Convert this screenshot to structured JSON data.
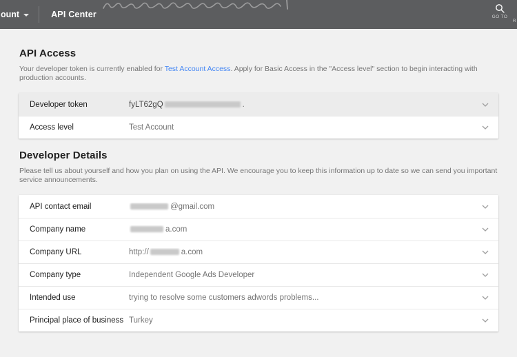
{
  "header": {
    "account_label": "ount",
    "title": "API Center",
    "goto_label": "GO TO",
    "partial_nav_label": "R"
  },
  "colors": {
    "header_bg": "#5c5d5f",
    "page_bg": "#f1f1f1",
    "link_blue": "#4285f4",
    "label_text": "#212121",
    "value_text": "#757575",
    "highlight_row_bg": "#ececec"
  },
  "sections": [
    {
      "title": "API Access",
      "description_before": "Your developer token is currently enabled for ",
      "description_link": "Test Account Access",
      "description_after": ". Apply for Basic Access in the \"Access level\" section to begin interacting with production accounts.",
      "rows": [
        {
          "label": "Developer token",
          "value_prefix": "fyLT62gQ",
          "prefix_dark": true,
          "redacted_width": 110,
          "value_suffix": ".",
          "highlight": true
        },
        {
          "label": "Access level",
          "value": "Test Account"
        }
      ]
    },
    {
      "title": "Developer Details",
      "description": "Please tell us about yourself and how you plan on using the API. We encourage you to keep this information up to date so we can send you important service announcements.",
      "rows": [
        {
          "label": "API contact email",
          "redacted_width": 55,
          "value_suffix": "@gmail.com"
        },
        {
          "label": "Company name",
          "redacted_width": 48,
          "value_suffix": "a.com"
        },
        {
          "label": "Company URL",
          "value_prefix": "http://",
          "redacted_width": 42,
          "value_suffix": "a.com"
        },
        {
          "label": "Company type",
          "value": "Independent Google Ads Developer"
        },
        {
          "label": "Intended use",
          "value": "trying to resolve some customers adwords problems..."
        },
        {
          "label": "Principal place of business",
          "value": "Turkey"
        }
      ]
    }
  ]
}
